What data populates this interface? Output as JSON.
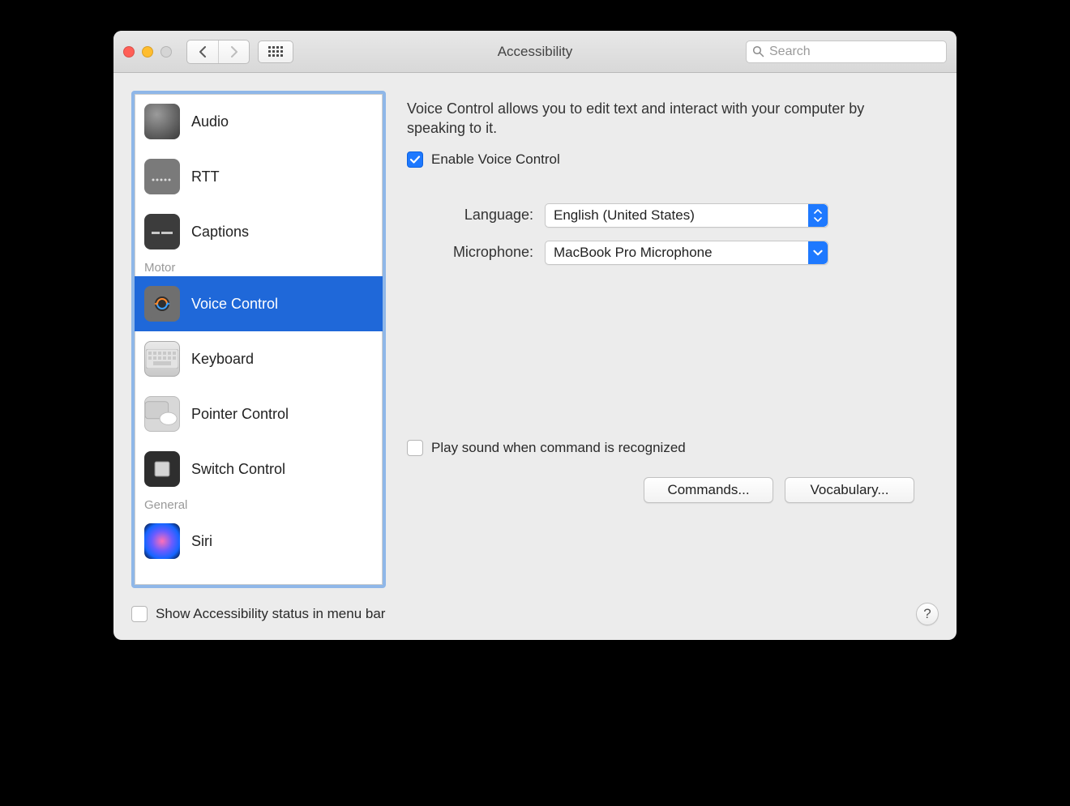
{
  "window": {
    "title": "Accessibility",
    "search_placeholder": "Search"
  },
  "sidebar": {
    "groups": [
      {
        "label": "",
        "items": [
          {
            "id": "audio",
            "label": "Audio"
          },
          {
            "id": "rtt",
            "label": "RTT"
          },
          {
            "id": "captions",
            "label": "Captions"
          }
        ]
      },
      {
        "label": "Motor",
        "items": [
          {
            "id": "voice-control",
            "label": "Voice Control",
            "selected": true
          },
          {
            "id": "keyboard",
            "label": "Keyboard"
          },
          {
            "id": "pointer-control",
            "label": "Pointer Control"
          },
          {
            "id": "switch-control",
            "label": "Switch Control"
          }
        ]
      },
      {
        "label": "General",
        "items": [
          {
            "id": "siri",
            "label": "Siri"
          }
        ]
      }
    ]
  },
  "detail": {
    "description": "Voice Control allows you to edit text and interact with your computer by speaking to it.",
    "enable_label": "Enable Voice Control",
    "enable_checked": true,
    "language_label": "Language:",
    "language_value": "English (United States)",
    "microphone_label": "Microphone:",
    "microphone_value": "MacBook Pro Microphone",
    "playsound_label": "Play sound when command is recognized",
    "playsound_checked": false,
    "commands_btn": "Commands...",
    "vocabulary_btn": "Vocabulary..."
  },
  "footer": {
    "menubar_label": "Show Accessibility status in menu bar",
    "menubar_checked": false,
    "help": "?"
  }
}
